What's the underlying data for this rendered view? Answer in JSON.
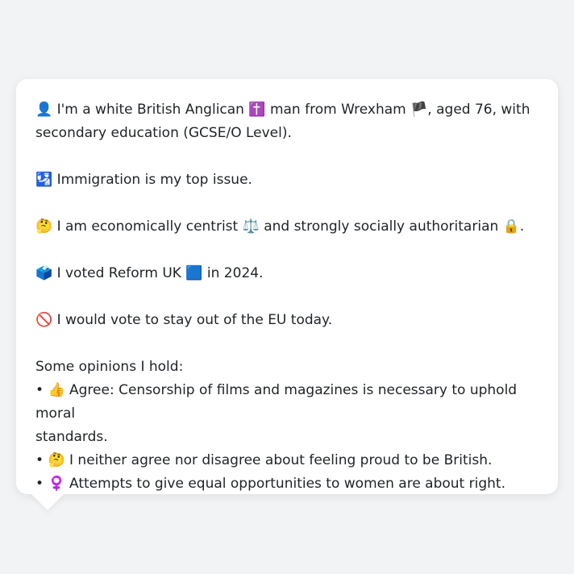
{
  "profile": {
    "intro_emoji": "👤",
    "intro_part1": "I'm a white British Anglican",
    "religion_emoji": "✝️",
    "intro_part2": "man from Wrexham",
    "flag_emoji": "🏴",
    "intro_part3": ", aged 76, with",
    "intro_line2": "secondary education (GCSE/O Level)."
  },
  "issue": {
    "emoji": "🛂",
    "text": "Immigration is my top issue."
  },
  "ideology": {
    "emoji": "🤔",
    "text1": "I am economically centrist",
    "scale_emoji": "⚖️",
    "text2": "and strongly socially authoritarian",
    "lock_emoji": "🔒",
    "text3": "."
  },
  "vote": {
    "emoji": "🗳️",
    "text1": "I voted Reform UK",
    "party_emoji": "🟦",
    "text2": "in 2024."
  },
  "eu": {
    "emoji": "🚫",
    "text": "I would vote to stay out of the EU today."
  },
  "opinions": {
    "heading": "Some opinions I hold:",
    "items": [
      {
        "bullet": "•",
        "emoji": "👍",
        "line1": "Agree: Censorship of films and magazines is necessary to uphold moral",
        "line2": "standards."
      },
      {
        "bullet": "•",
        "emoji": "🤔",
        "line1": "I neither agree nor disagree about feeling proud to be British."
      },
      {
        "bullet": "•",
        "emoji": "♀️",
        "line1": "Attempts to give equal opportunities to women are about right."
      }
    ]
  }
}
